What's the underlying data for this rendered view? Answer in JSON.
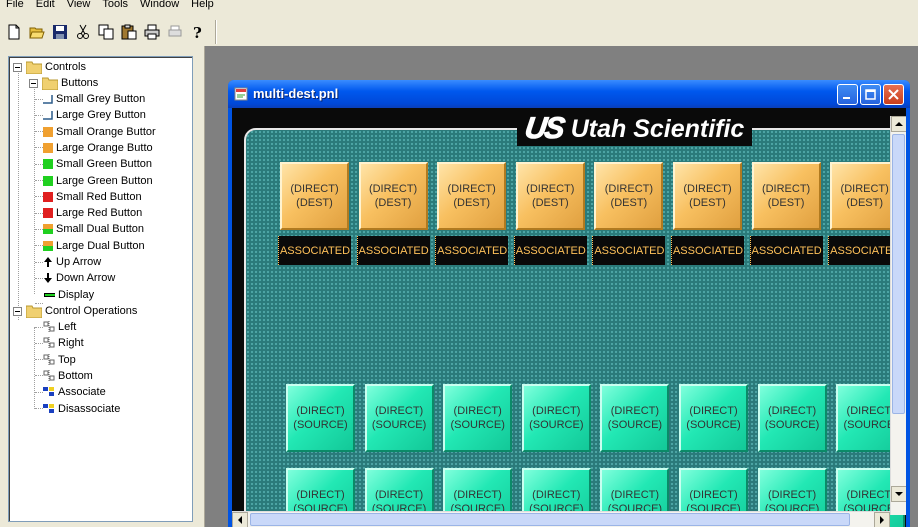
{
  "menu": [
    "File",
    "Edit",
    "View",
    "Tools",
    "Window",
    "Help"
  ],
  "toolbar": {
    "buttons": [
      "new-icon",
      "open-icon",
      "save-icon",
      "cut-icon",
      "copy-icon",
      "paste-icon",
      "print-icon",
      "print-preview-icon",
      "help-icon"
    ]
  },
  "tree": {
    "root": "Controls",
    "buttons_folder": "Buttons",
    "buttons": [
      {
        "label": "Small Grey Button",
        "color": "#2b5c8a"
      },
      {
        "label": "Large Grey Button",
        "color": "#2b5c8a"
      },
      {
        "label": "Small Orange Buttor",
        "color": "#f0a030"
      },
      {
        "label": "Large Orange Butto",
        "color": "#f0a030"
      },
      {
        "label": "Small Green Button",
        "color": "#20d020"
      },
      {
        "label": "Large Green Button",
        "color": "#20d020"
      },
      {
        "label": "Small Red Button",
        "color": "#e02020"
      },
      {
        "label": "Large Red Button",
        "color": "#e02020"
      },
      {
        "label": "Small Dual Button",
        "color": "#f0a030"
      },
      {
        "label": "Large Dual Button",
        "color": "#f0a030"
      },
      {
        "label": "Up Arrow",
        "color": "#000000"
      },
      {
        "label": "Down Arrow",
        "color": "#000000"
      }
    ],
    "display": "Display",
    "operations_folder": "Control Operations",
    "operations": [
      "Left",
      "Right",
      "Top",
      "Bottom",
      "Associate",
      "Disassociate"
    ]
  },
  "window": {
    "title": "multi-dest.pnl",
    "logo_mark": "US",
    "logo_brand": "Utah Scientific"
  },
  "panel": {
    "dest_line1": "(DIRECT)",
    "dest_line2": "(DEST)",
    "assoc_label": "ASSOCIATED",
    "src_line1": "(DIRECT)",
    "src_line2": "(SOURCE)",
    "colors": {
      "dest": "#f8c060",
      "source": "#22e8b4",
      "background": "#2a7a7a",
      "assoc_text": "#ffc25a"
    }
  }
}
